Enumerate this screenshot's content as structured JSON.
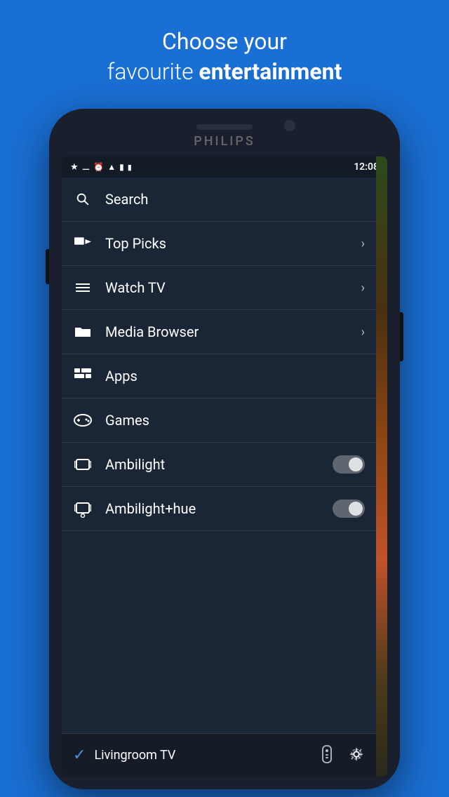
{
  "header": {
    "line1_normal": "Choose your",
    "line2_prefix": "favourite ",
    "line2_bold": "entertainment"
  },
  "phone": {
    "brand": "PHILIPS"
  },
  "status_bar": {
    "time": "12:08",
    "icons": [
      "bluetooth",
      "minus-circle",
      "clock",
      "wifi",
      "signal",
      "battery"
    ]
  },
  "menu": {
    "items": [
      {
        "id": "search",
        "icon": "search",
        "label": "Search",
        "has_chevron": false,
        "has_toggle": false
      },
      {
        "id": "top-picks",
        "icon": "star",
        "label": "Top Picks",
        "has_chevron": true,
        "has_toggle": false
      },
      {
        "id": "watch-tv",
        "icon": "tv",
        "label": "Watch TV",
        "has_chevron": true,
        "has_toggle": false
      },
      {
        "id": "media-browser",
        "icon": "folder",
        "label": "Media Browser",
        "has_chevron": true,
        "has_toggle": false
      },
      {
        "id": "apps",
        "icon": "apps",
        "label": "Apps",
        "has_chevron": false,
        "has_toggle": false
      },
      {
        "id": "games",
        "icon": "gamepad",
        "label": "Games",
        "has_chevron": false,
        "has_toggle": false
      },
      {
        "id": "ambilight",
        "icon": "ambilight",
        "label": "Ambilight",
        "has_chevron": false,
        "has_toggle": true
      },
      {
        "id": "ambilight-hue",
        "icon": "ambilight-hue",
        "label": "Ambilight+hue",
        "has_chevron": false,
        "has_toggle": true
      }
    ]
  },
  "bottom_bar": {
    "tv_name": "Livingroom TV",
    "check_icon": "✓",
    "remote_icon": "remote",
    "settings_icon": "gear"
  }
}
